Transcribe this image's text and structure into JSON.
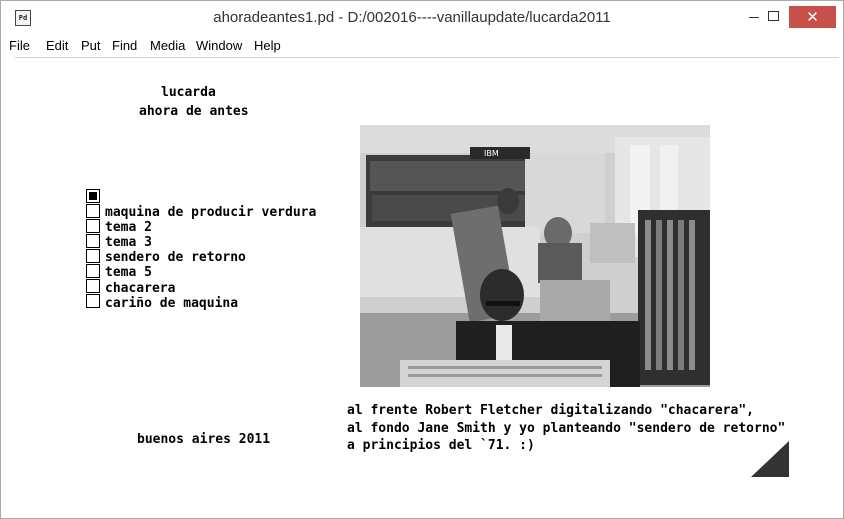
{
  "window": {
    "title": "ahoradeantes1.pd  - D:/002016----vanillaupdate/lucarda2011",
    "app_icon_text": "Pd",
    "close_glyph": "✕"
  },
  "menu": {
    "items": [
      "File",
      "Edit",
      "Put",
      "Find",
      "Media",
      "Window",
      "Help"
    ]
  },
  "patch": {
    "heading": "lucarda",
    "subheading": "ahora de antes",
    "radio_items": [
      "maquina de producir verdura",
      "tema 2",
      "tema 3",
      "sendero de retorno",
      "tema 5",
      "chacarera",
      "cariño de maquina"
    ],
    "radio_selected": 0,
    "footer_left": "buenos aires 2011",
    "caption_lines": [
      "al frente Robert Fletcher digitalizando \"chacarera\",",
      "al fondo Jane Smith y yo planteando \"sendero de retorno\"",
      "a principios del `71. :)"
    ],
    "photo_label": "IBM"
  }
}
